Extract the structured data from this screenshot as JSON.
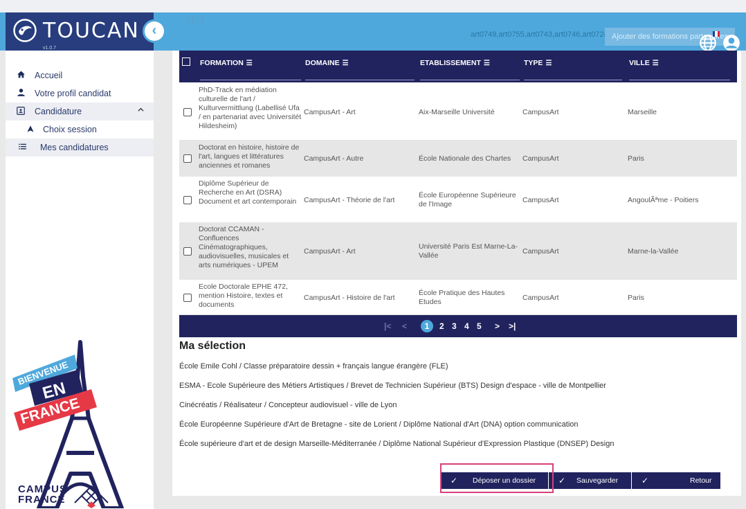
{
  "app": {
    "name": "TOUCAN",
    "version": "v1.0.7",
    "collapse_glyph": "‹"
  },
  "topbar": {
    "faded_text": "(                    )     (          )",
    "codes": "art0749,art0755,art0743,art0746,art072(",
    "add_button": "Ajouter des formations partenaires"
  },
  "sidebar": {
    "items": [
      {
        "label": "Accueil",
        "icon": "home-icon"
      },
      {
        "label": "Votre profil candidat",
        "icon": "person-icon"
      },
      {
        "label": "Candidature",
        "icon": "application-icon",
        "expanded": true
      },
      {
        "label": "Choix session",
        "icon": "bookmark-icon"
      },
      {
        "label": "Mes candidatures",
        "icon": "list-icon"
      }
    ],
    "banner": {
      "line1": "BIENVENUE",
      "line2": "EN",
      "line3": "FRANCE"
    },
    "campus": {
      "line1": "CAMPUS",
      "line2": "FRANCE"
    }
  },
  "table": {
    "headers": [
      "FORMATION",
      "DOMAINE",
      "ETABLISSEMENT",
      "TYPE",
      "VILLE"
    ],
    "rows": [
      {
        "formation": "PhD-Track en médiation culturelle de l'art / Kulturvermittlung (Labellisé Ufa / en partenariat avec Universitét Hildesheim)",
        "domaine": "CampusArt - Art",
        "etablissement": "Aix-Marseille Université",
        "type": "CampusArt",
        "ville": "Marseille"
      },
      {
        "formation": "Doctorat en histoire, histoire de l'art, langues et littératures anciennes et romanes",
        "domaine": "CampusArt - Autre",
        "etablissement": "École Nationale des Chartes",
        "type": "CampusArt",
        "ville": "Paris"
      },
      {
        "formation": "Diplôme Supérieur de Recherche en Art (DSRA) Document et art contemporain",
        "domaine": "CampusArt - Théorie de l'art",
        "etablissement": "École Européenne Supérieure de l'Image",
        "type": "CampusArt",
        "ville": "AngoulÃªme - Poitiers"
      },
      {
        "formation": "Doctorat CCAMAN - Confluences Cinématographiques, audiovisuelles, musicales et arts numériques - UPEM",
        "domaine": "CampusArt - Art",
        "etablissement": "Université Paris Est Marne-La-Vallée",
        "type": "CampusArt",
        "ville": "Marne-la-Vallée"
      },
      {
        "formation": "Ecole Doctorale EPHE 472, mention Histoire, textes et documents",
        "domaine": "CampusArt - Histoire de l'art",
        "etablissement": "École Pratique des Hautes Etudes",
        "type": "CampusArt",
        "ville": "Paris"
      }
    ]
  },
  "pagination": {
    "first": "|<",
    "prev": "<",
    "current": "1",
    "pages": [
      "2",
      "3",
      "4",
      "5"
    ],
    "next": ">",
    "last": ">|"
  },
  "selection": {
    "title": "Ma sélection",
    "items": [
      "École Emile Cohl / Classe préparatoire dessin + français langue érangère (FLE)",
      "ESMA - Ecole Supérieure des Métiers Artistiques / Brevet de Technicien Supérieur (BTS) Design d'espace - ville de Montpellier",
      "Cinécréatis / Réalisateur / Concepteur audiovisuel - ville de Lyon",
      "École Européenne Supérieure d'Art de Bretagne - site de Lorient / Diplôme National d'Art (DNA) option communication",
      "École supérieure d'art et de design Marseille-Méditerranée / Diplôme National Supérieur d'Expression Plastique (DNSEP) Design"
    ]
  },
  "actions": {
    "deposer": "Déposer un dossier",
    "sauvegarder": "Sauvegarder",
    "retour": "Retour",
    "check": "✓"
  },
  "colors": {
    "navy": "#21235e",
    "sky": "#4fa8dc",
    "logo_bar": "#273d7d",
    "highlight": "#d8407a"
  }
}
